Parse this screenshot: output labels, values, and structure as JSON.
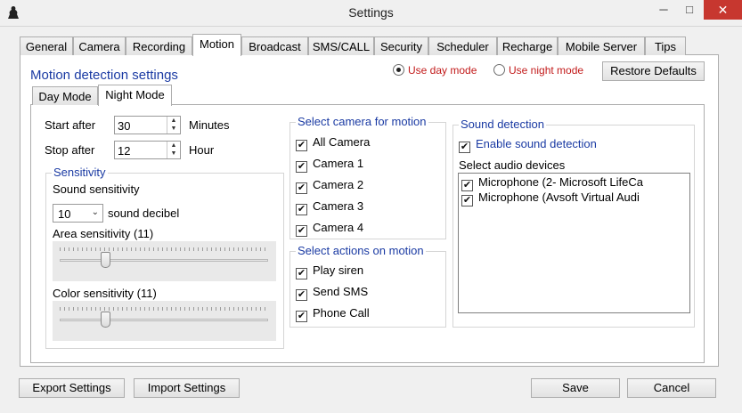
{
  "window": {
    "title": "Settings",
    "minimize": "─",
    "maximize": "□",
    "close": "✕"
  },
  "tabs": [
    "General",
    "Camera",
    "Recording",
    "Motion",
    "Broadcast",
    "SMS/CALL",
    "Security",
    "Scheduler",
    "Recharge",
    "Mobile Server",
    "Tips"
  ],
  "active_tab": "Motion",
  "motion": {
    "heading": "Motion detection settings",
    "day_mode_label": "Use day mode",
    "night_mode_label": "Use night mode",
    "selected_mode": "day",
    "restore_defaults": "Restore Defaults",
    "subtabs": [
      "Day Mode",
      "Night Mode"
    ],
    "active_subtab": "Night Mode"
  },
  "timing": {
    "start_after_label": "Start after",
    "start_after_value": "30",
    "start_after_unit": "Minutes",
    "stop_after_label": "Stop after",
    "stop_after_value": "12",
    "stop_after_unit": "Hour"
  },
  "sensitivity": {
    "title": "Sensitivity",
    "sound_label": "Sound sensitivity",
    "sound_value": "10",
    "sound_unit": "sound decibel",
    "area_label": "Area sensitivity (11)",
    "area_value": 11,
    "color_label": "Color sensitivity (11)",
    "color_value": 11,
    "slider_max": 50
  },
  "cameras": {
    "title": "Select camera for motion",
    "items": [
      {
        "label": "All Camera",
        "checked": true
      },
      {
        "label": "Camera 1",
        "checked": true
      },
      {
        "label": "Camera 2",
        "checked": true
      },
      {
        "label": "Camera 3",
        "checked": true
      },
      {
        "label": "Camera 4",
        "checked": true
      }
    ]
  },
  "actions": {
    "title": "Select actions on motion",
    "items": [
      {
        "label": "Play siren",
        "checked": true
      },
      {
        "label": "Send SMS",
        "checked": true
      },
      {
        "label": "Phone Call",
        "checked": true
      }
    ]
  },
  "sound": {
    "title": "Sound detection",
    "enable_label": "Enable sound detection",
    "enable_checked": true,
    "devices_label": "Select audio devices",
    "devices": [
      {
        "label": "Microphone (2- Microsoft LifeCa",
        "checked": true
      },
      {
        "label": "Microphone (Avsoft Virtual Audi",
        "checked": true
      }
    ]
  },
  "footer": {
    "export": "Export Settings",
    "import": "Import Settings",
    "save": "Save",
    "cancel": "Cancel"
  },
  "colors": {
    "heading": "#1a3aa3",
    "radio_label": "#c21a1a",
    "close_button": "#c7372f"
  },
  "check_glyph": "✔"
}
